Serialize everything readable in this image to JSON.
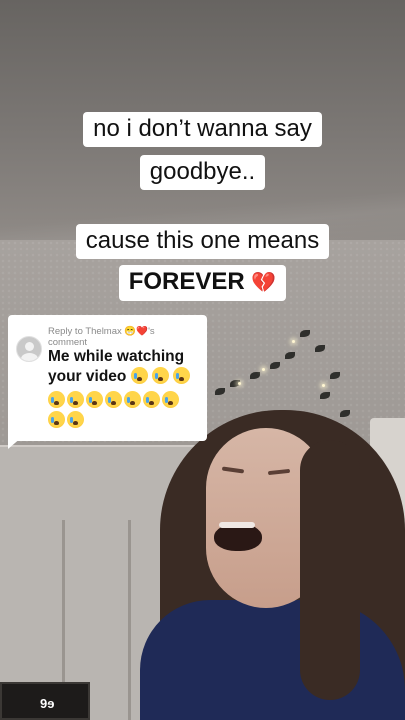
{
  "caption": {
    "line1": "no i don’t wanna say",
    "line2": "goodbye..",
    "line3": "cause this one means",
    "line4": "FOREVER",
    "line4_emoji": "💔"
  },
  "reply": {
    "reply_to_prefix": "Reply to Thelmax",
    "reply_to_emojis": "😁❤️",
    "reply_to_suffix": "'s",
    "reply_to_line2": "comment",
    "comment_text_line1": "Me while watching",
    "comment_text_line2": "your video",
    "avatar_icon": "default-avatar-icon",
    "emoji_icon": "loudly-crying-face-icon",
    "emoji_count_line2": 3,
    "emoji_count_line3": 7,
    "emoji_count_line4": 2
  },
  "background": {
    "frame_text": "9ɘ"
  }
}
